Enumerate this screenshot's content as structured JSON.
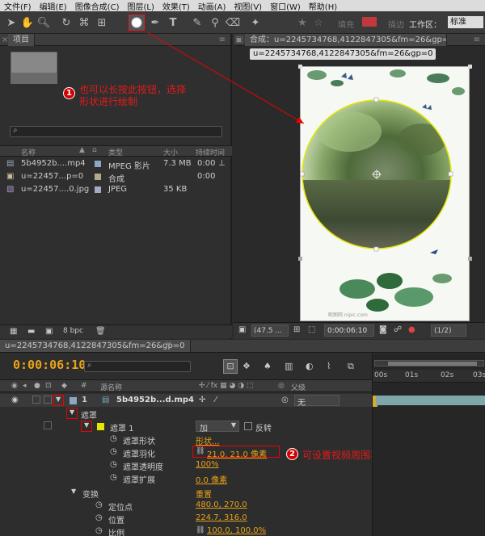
{
  "menu": [
    "文件(F)",
    "编辑(E)",
    "图像合成(C)",
    "图层(L)",
    "效果(T)",
    "动画(A)",
    "视图(V)",
    "窗口(W)",
    "帮助(H)"
  ],
  "toolbar": {
    "tools": [
      "selection-tool",
      "hand-tool",
      "zoom-tool",
      "rotation-tool",
      "camera-tool",
      "pan-behind-tool",
      "ellipse-mask-tool",
      "pen-tool",
      "text-tool",
      "brush-tool",
      "clone-stamp-tool",
      "eraser-tool",
      "puppet-tool"
    ],
    "fill_label": "填充",
    "stroke_label": "描边",
    "workspace_label": "工作区：",
    "workspace_value": "标准"
  },
  "project": {
    "tab_label": "项目",
    "columns": [
      "名称",
      "类型",
      "大小",
      "持续时间"
    ],
    "items": [
      {
        "name": "5b4952b....mp4",
        "type": "MPEG 影片",
        "size": "7.3 MB",
        "duration": "0:00",
        "color": "#8aa7c5"
      },
      {
        "name": "u=22457...p=0",
        "type": "合成",
        "size": "",
        "duration": "0:00",
        "color": "#b8a98a"
      },
      {
        "name": "u=22457....0.jpg",
        "type": "JPEG",
        "size": "35 KB",
        "duration": "",
        "color": "#a7a7c7"
      }
    ],
    "bpc": "8 bpc"
  },
  "annotation1": {
    "number": "1",
    "text_line1": "也可以长按此按钮，选择",
    "text_line2": "形状进行绘制"
  },
  "annotation2": {
    "number": "2",
    "text": "可设置视频周围羽化效果"
  },
  "comp": {
    "tab_label": "合成：u=2245734768,4122847305&fm=26&gp=0",
    "crumb": "u=2245734768,4122847305&fm=26&gp=0",
    "zoom": "(47.5 ...",
    "timecode": "0:00:06:10",
    "resolution": "(1/2)",
    "watermark": "昵图网 nipic.com"
  },
  "timeline": {
    "tab_label": "u=2245734768,4122847305&fm=26&gp=0",
    "current_time": "0:00:06:10",
    "col_hash": "#",
    "col_source": "源名称",
    "col_parent": "父级",
    "ruler": [
      "00s",
      "01s",
      "02s",
      "03s"
    ],
    "layer": {
      "index": "1",
      "name": "5b4952b...d.mp4",
      "parent": "无"
    },
    "mask_group": "遮罩",
    "mask": {
      "name": "遮罩 1",
      "mode": "加",
      "invert": "反转"
    },
    "properties": [
      {
        "name": "遮罩形状",
        "value": "形状..."
      },
      {
        "name": "遮罩羽化",
        "value": "21.0, 21.0 像素"
      },
      {
        "name": "遮罩透明度",
        "value": "100%"
      },
      {
        "name": "遮罩扩展",
        "value": "0.0 像素"
      }
    ],
    "transform_label": "变换",
    "transform_reset": "重置",
    "transform": [
      {
        "name": "定位点",
        "value": "480.0, 270.0"
      },
      {
        "name": "位置",
        "value": "224.7, 316.0"
      },
      {
        "name": "比例",
        "value": "100.0, 100.0%"
      }
    ]
  }
}
